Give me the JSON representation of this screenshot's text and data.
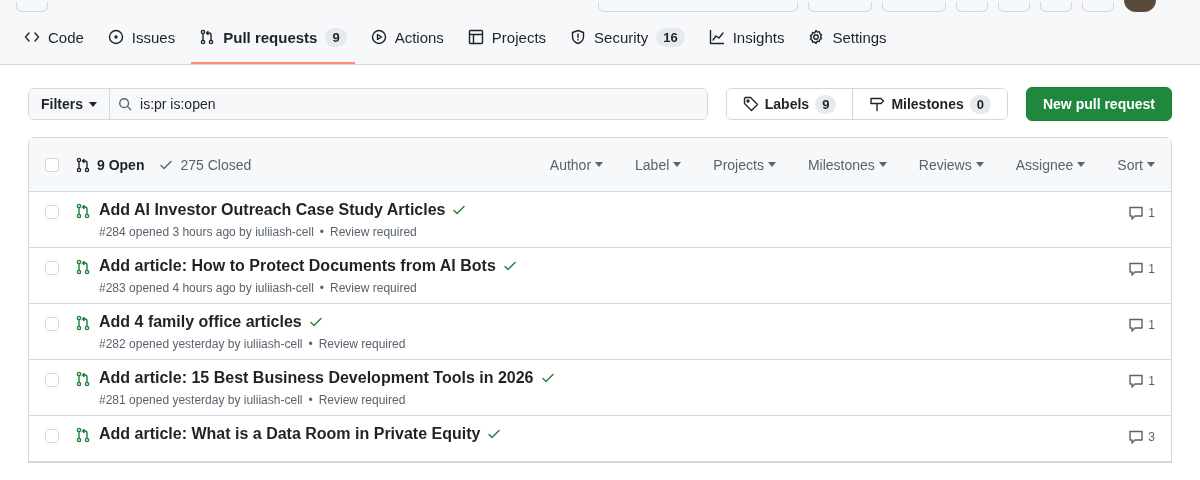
{
  "tabs": [
    {
      "label": "Code",
      "kind": "code",
      "selected": false
    },
    {
      "label": "Issues",
      "kind": "issue",
      "selected": false
    },
    {
      "label": "Pull requests",
      "kind": "pr",
      "count": "9",
      "selected": true
    },
    {
      "label": "Actions",
      "kind": "play",
      "selected": false
    },
    {
      "label": "Projects",
      "kind": "table",
      "selected": false
    },
    {
      "label": "Security",
      "kind": "shield",
      "count": "16",
      "selected": false
    },
    {
      "label": "Insights",
      "kind": "graph",
      "selected": false
    },
    {
      "label": "Settings",
      "kind": "gear",
      "selected": false
    }
  ],
  "filters": {
    "button": "Filters",
    "query": "is:pr is:open",
    "labels": {
      "label": "Labels",
      "count": "9"
    },
    "milestones": {
      "label": "Milestones",
      "count": "0"
    },
    "new_button": "New pull request"
  },
  "list_header": {
    "checked": false,
    "open": {
      "label": "9 Open",
      "selected": true
    },
    "closed": {
      "label": "275 Closed",
      "selected": false
    },
    "menus": [
      "Author",
      "Label",
      "Projects",
      "Milestones",
      "Reviews",
      "Assignee",
      "Sort"
    ]
  },
  "pull_requests": [
    {
      "checked": false,
      "title": "Add AI Investor Outreach Case Study Articles",
      "meta": "#284 opened 3 hours ago by iuliiash-cell",
      "separator": "•",
      "review": "Review required",
      "checks_passed": true,
      "comments": "1"
    },
    {
      "checked": false,
      "title": "Add article: How to Protect Documents from AI Bots",
      "meta": "#283 opened 4 hours ago by iuliiash-cell",
      "separator": "•",
      "review": "Review required",
      "checks_passed": true,
      "comments": "1"
    },
    {
      "checked": false,
      "title": "Add 4 family office articles",
      "meta": "#282 opened yesterday by iuliiash-cell",
      "separator": "•",
      "review": "Review required",
      "checks_passed": true,
      "comments": "1"
    },
    {
      "checked": false,
      "title": "Add article: 15 Best Business Development Tools in 2026",
      "meta": "#281 opened yesterday by iuliiash-cell",
      "separator": "•",
      "review": "Review required",
      "checks_passed": true,
      "comments": "1"
    },
    {
      "checked": false,
      "title": "Add article: What is a Data Room in Private Equity",
      "checks_passed": true,
      "comments": "3"
    }
  ]
}
